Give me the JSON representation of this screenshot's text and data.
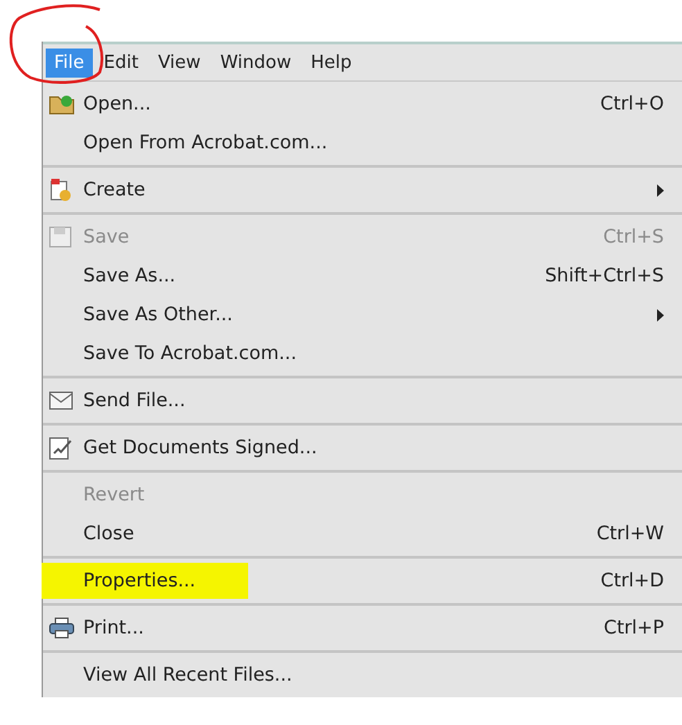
{
  "menu_bar": [
    {
      "label": "File",
      "selected": true
    },
    {
      "label": "Edit",
      "selected": false
    },
    {
      "label": "View",
      "selected": false
    },
    {
      "label": "Window",
      "selected": false
    },
    {
      "label": "Help",
      "selected": false
    }
  ],
  "menu_sections": [
    {
      "items": [
        {
          "label": "Open...",
          "shortcut": "Ctrl+O",
          "kind": "folder",
          "disabled": false
        },
        {
          "label": "Open From Acrobat.com...",
          "kind": "plain",
          "disabled": false
        }
      ]
    },
    {
      "items": [
        {
          "label": "Create",
          "kind": "create",
          "submenu": true,
          "disabled": false
        }
      ]
    },
    {
      "items": [
        {
          "label": "Save",
          "shortcut": "Ctrl+S",
          "kind": "disk",
          "disabled": true
        },
        {
          "label": "Save As...",
          "shortcut": "Shift+Ctrl+S",
          "kind": "plain",
          "disabled": false
        },
        {
          "label": "Save As Other...",
          "kind": "plain",
          "submenu": true,
          "disabled": false
        },
        {
          "label": "Save To Acrobat.com...",
          "kind": "plain",
          "disabled": false
        }
      ]
    },
    {
      "items": [
        {
          "label": "Send File...",
          "kind": "envelope",
          "disabled": false
        }
      ]
    },
    {
      "items": [
        {
          "label": "Get Documents Signed...",
          "kind": "sign",
          "disabled": false
        }
      ]
    },
    {
      "items": [
        {
          "label": "Revert",
          "kind": "plain",
          "disabled": true
        },
        {
          "label": "Close",
          "shortcut": "Ctrl+W",
          "kind": "plain",
          "disabled": false
        }
      ]
    },
    {
      "items": [
        {
          "label": "Properties...",
          "shortcut": "Ctrl+D",
          "kind": "plain",
          "highlighted": true,
          "disabled": false
        }
      ]
    },
    {
      "items": [
        {
          "label": "Print...",
          "shortcut": "Ctrl+P",
          "kind": "printer",
          "disabled": false
        }
      ]
    },
    {
      "items": [
        {
          "label": "View All Recent Files...",
          "kind": "plain",
          "disabled": false
        }
      ]
    }
  ]
}
